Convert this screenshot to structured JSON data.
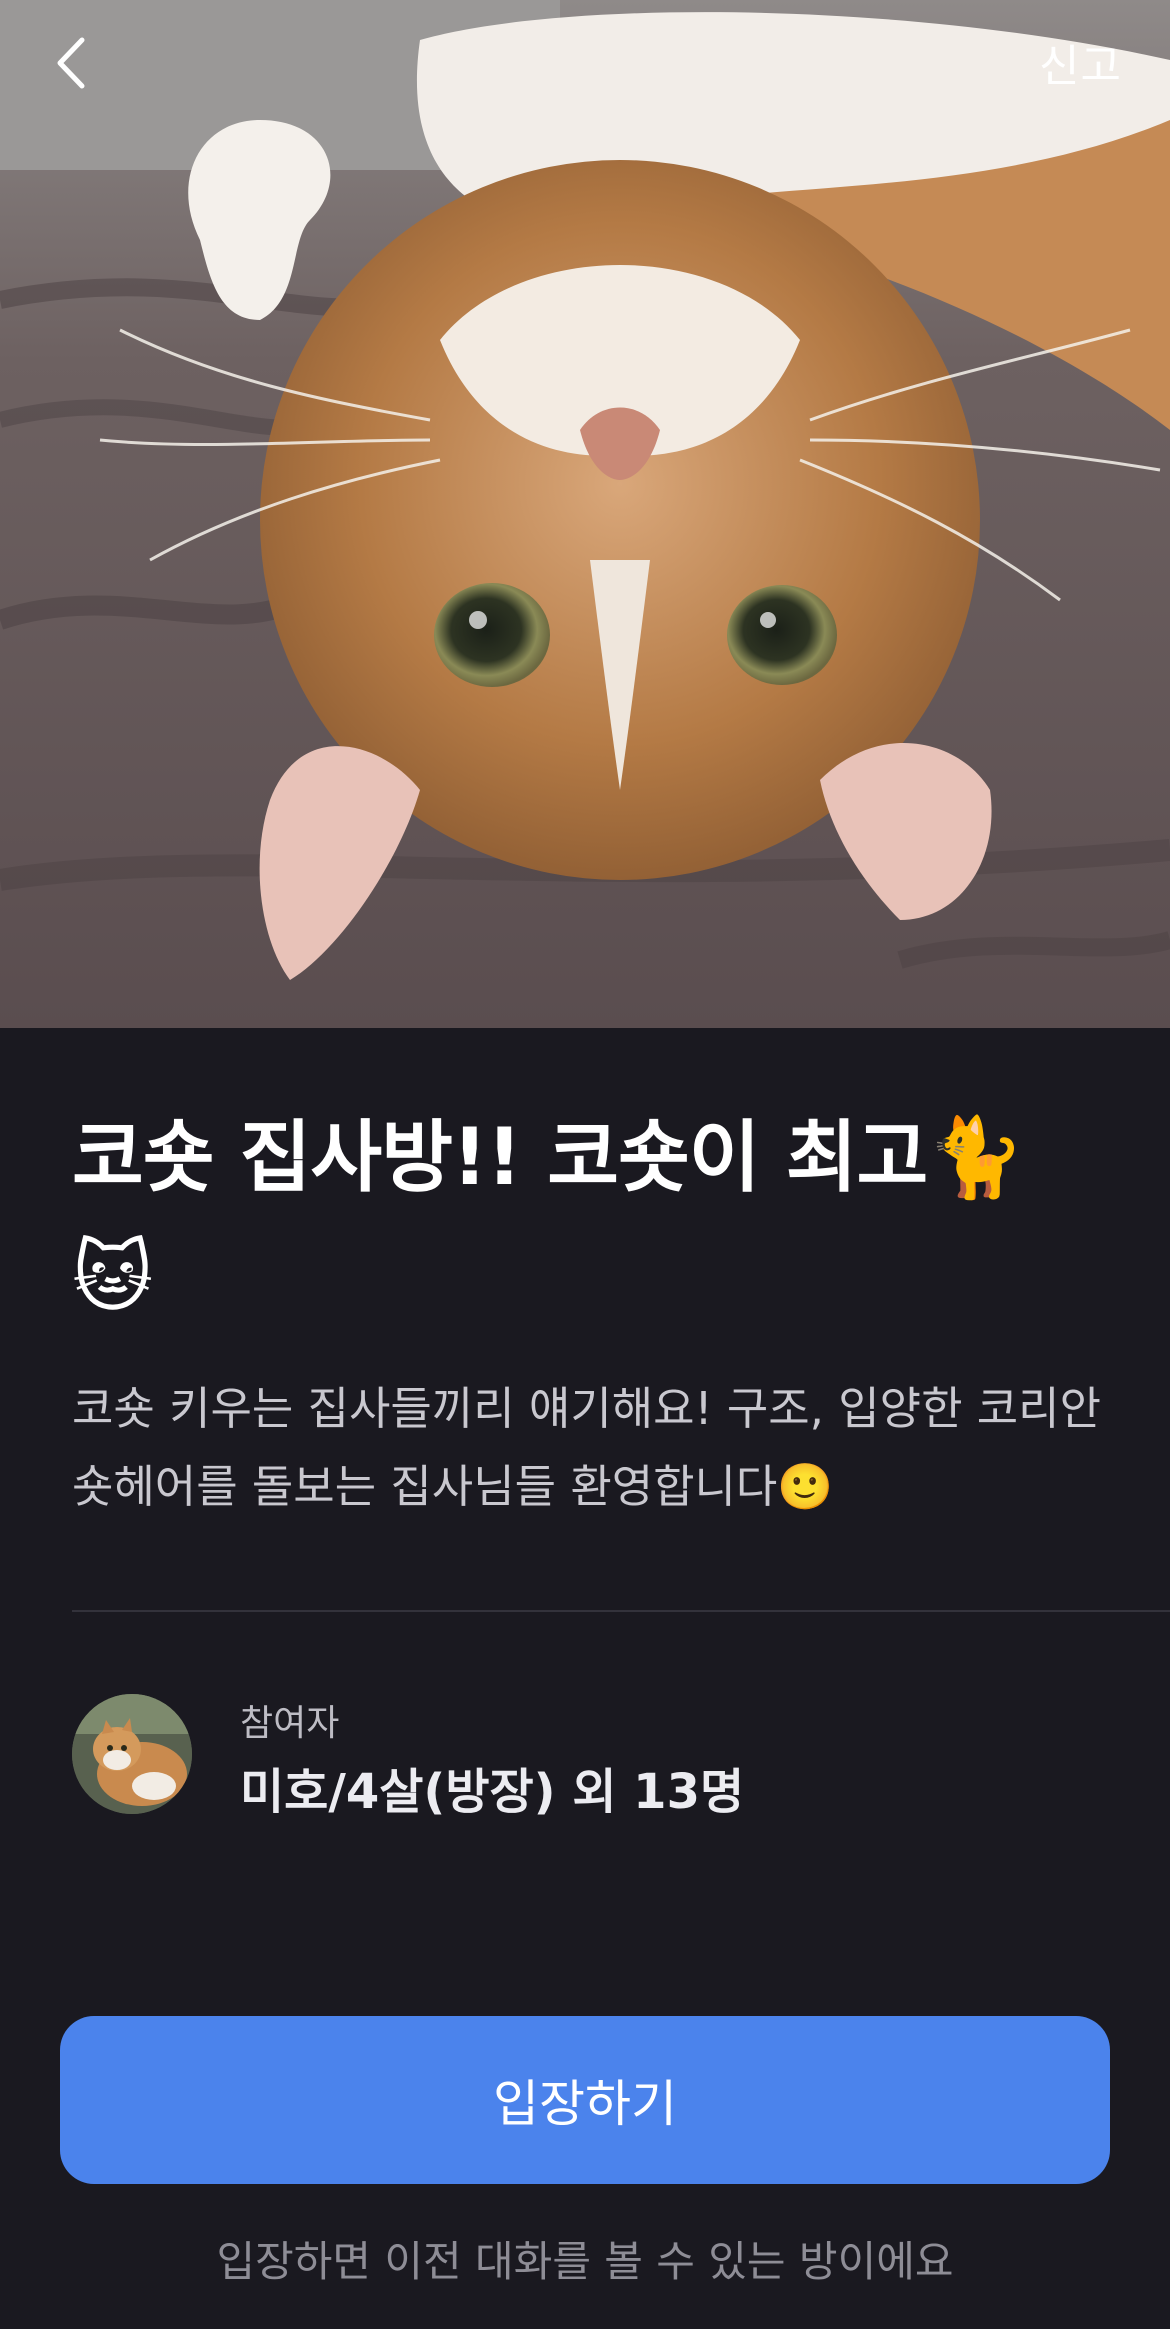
{
  "header": {
    "back_icon": "chevron-left-icon",
    "report_label": "신고"
  },
  "hero": {
    "image": "cat-photo"
  },
  "room": {
    "title": "코숏 집사방!! 코숏이 최고🐈🐱",
    "description": "코숏 키우는 집사들끼리 얘기해요! 구조, 입양한 코리안숏헤어를 돌보는 집사님들 환영합니다🙂"
  },
  "participants": {
    "label": "참여자",
    "summary": "미호/4살(방장) 외 13명"
  },
  "actions": {
    "enter_label": "입장하기",
    "notice": "입장하면 이전 대화를 볼 수 있는 방이에요"
  },
  "colors": {
    "background": "#1a1920",
    "accent": "#4b83ec",
    "divider": "#33323b",
    "muted_text": "#8e8d96"
  }
}
